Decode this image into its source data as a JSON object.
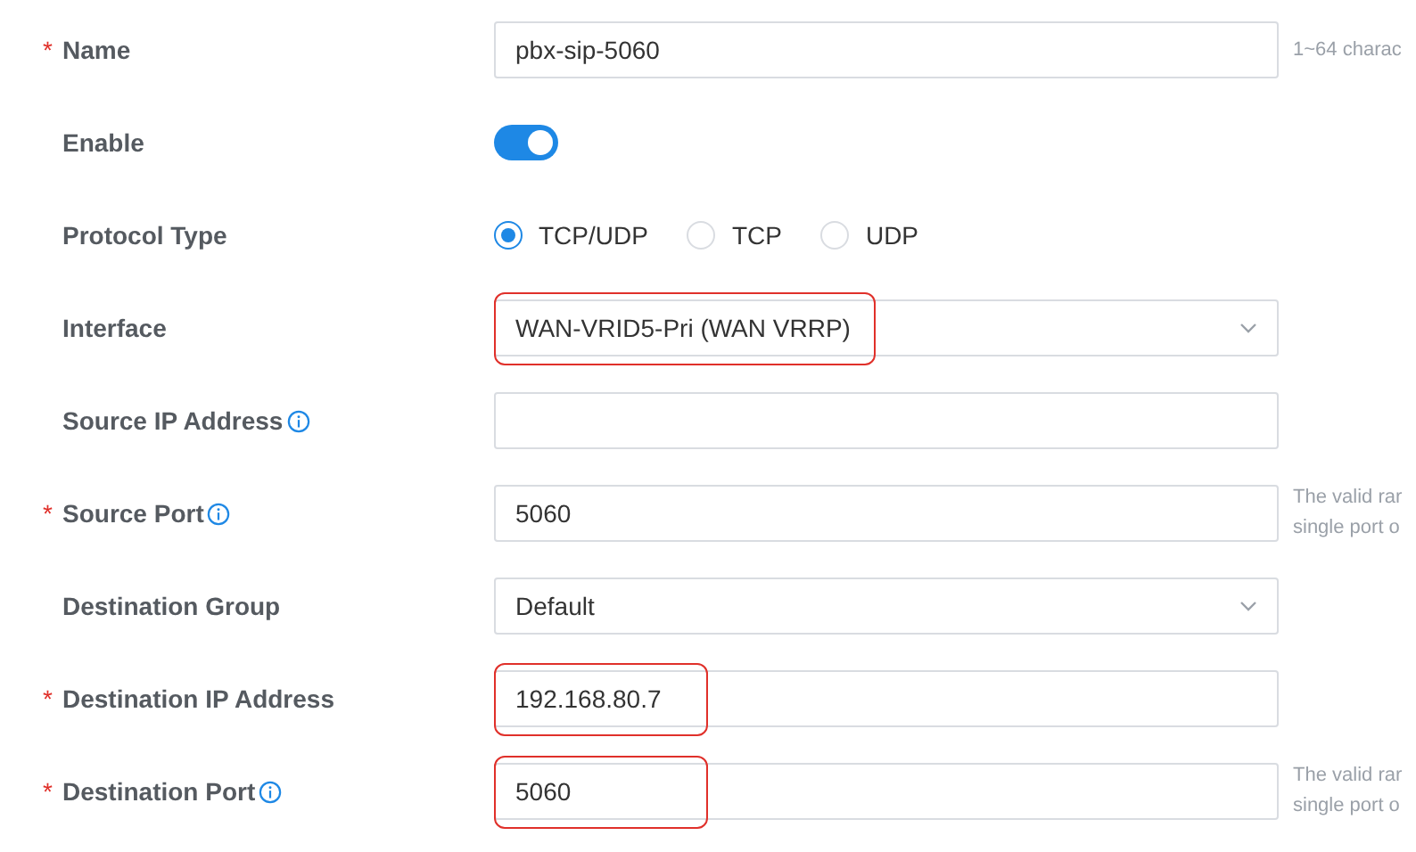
{
  "fields": [
    {
      "kind": "text",
      "label": "Name",
      "marker": "*",
      "info": false,
      "value": "pbx-sip-5060",
      "highlighted": false,
      "help": [
        "1~64 charac"
      ]
    },
    {
      "kind": "switch",
      "label": "Enable",
      "info": false,
      "on": true
    },
    {
      "kind": "radio",
      "label": "Protocol Type",
      "info": false,
      "options": [
        {
          "label": "TCP/UDP",
          "selected": true
        },
        {
          "label": "TCP",
          "selected": false
        },
        {
          "label": "UDP",
          "selected": false
        }
      ]
    },
    {
      "kind": "select",
      "label": "Interface",
      "info": false,
      "value": "WAN-VRID5-Pri (WAN VRRP)",
      "highlighted": true
    },
    {
      "kind": "text",
      "label": "Source IP Address",
      "info": true,
      "highlighted": false
    },
    {
      "kind": "text",
      "label": "Source Port",
      "marker": "*",
      "info": true,
      "value": "5060",
      "highlighted": false,
      "help": [
        "The valid rar",
        "single port o"
      ]
    },
    {
      "kind": "select",
      "label": "Destination Group",
      "info": false,
      "value": "Default",
      "highlighted": false
    },
    {
      "kind": "text",
      "label": "Destination IP Address",
      "marker": "*",
      "info": false,
      "value": "192.168.80.7",
      "highlighted": true
    },
    {
      "kind": "text",
      "label": "Destination Port",
      "marker": "*",
      "info": true,
      "value": "5060",
      "highlighted": true,
      "help": [
        "The valid rar",
        "single port o"
      ]
    }
  ]
}
